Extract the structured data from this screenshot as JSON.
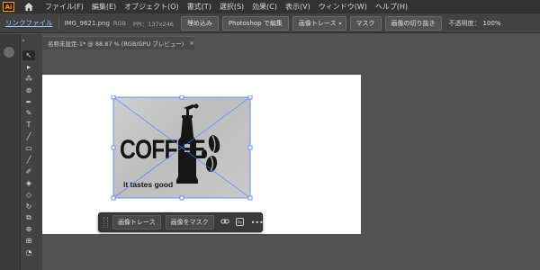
{
  "app": {
    "logo_text": "Ai"
  },
  "menu": {
    "items": [
      {
        "label": "ファイル(F)"
      },
      {
        "label": "編集(E)"
      },
      {
        "label": "オブジェクト(O)"
      },
      {
        "label": "書式(T)"
      },
      {
        "label": "選択(S)"
      },
      {
        "label": "効果(C)"
      },
      {
        "label": "表示(V)"
      },
      {
        "label": "ウィンドウ(W)"
      },
      {
        "label": "ヘルプ(H)"
      }
    ]
  },
  "control_bar": {
    "linked_file_label": "リンクファイル",
    "filename": "IMG_9621.png",
    "color_mode": "RGB",
    "ppi": "PPI：137x246",
    "embed_label": "埋め込み",
    "photoshop_edit_label": "Photoshop で編集",
    "image_trace_label": "画像トレース",
    "mask_label": "マスク",
    "crop_label": "画像の切り抜き",
    "opacity_label": "不透明度：",
    "opacity_value": "100%"
  },
  "document_tab": {
    "label": "名称未設定-1* @ 88.87 % (RGB/GPU プレビュー)",
    "close_glyph": "×"
  },
  "placed_image": {
    "main_text": "COFFEE",
    "tagline": "it tastes good"
  },
  "tools": [
    "↖",
    "▸",
    "⁂",
    "⊛",
    "✒",
    "✎",
    "T",
    "╱",
    "▭",
    "╱",
    "✐",
    "◈",
    "◇",
    "↻",
    "⧉",
    "⊕",
    "⊞",
    "◔"
  ],
  "task_bar": {
    "trace_label": "画像トレース",
    "mask_label": "画像をマスク",
    "more_glyph": "•••"
  },
  "colors": {
    "menubar_bg": "#323232",
    "panel_bg": "#424242",
    "canvas_bg": "#535353",
    "selection": "#4a7cff"
  }
}
